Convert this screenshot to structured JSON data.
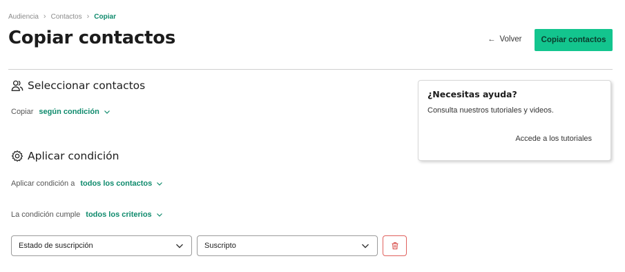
{
  "breadcrumb": {
    "items": [
      "Audiencia",
      "Contactos"
    ],
    "current": "Copiar",
    "separator": "›"
  },
  "header": {
    "title": "Copiar contactos",
    "back_label": "Volver",
    "primary_label": "Copiar contactos",
    "accent_color": "#13c58e"
  },
  "select_section": {
    "title": "Seleccionar contactos",
    "icon": "users-icon",
    "copy_label": "Copiar",
    "copy_value": "según condición"
  },
  "condition_section": {
    "title": "Aplicar condición",
    "icon": "gear-icon",
    "apply_label": "Aplicar condición a",
    "apply_value": "todos los contactos",
    "match_label": "La condición cumple",
    "match_value": "todos los criterios",
    "field_select": "Estado de suscripción",
    "value_select": "Suscripto"
  },
  "help": {
    "title": "¿Necesitas ayuda?",
    "text": "Consulta nuestros tutoriales y videos.",
    "link": "Accede a los tutoriales"
  }
}
